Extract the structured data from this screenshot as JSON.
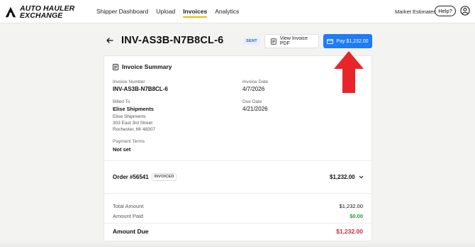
{
  "brand": {
    "line1": "AUTO HAULER",
    "line2": "EXCHANGE"
  },
  "nav": {
    "items": [
      "Shipper Dashboard",
      "Upload",
      "Invoices",
      "Analytics"
    ],
    "active": "Invoices",
    "market_estimates": "Market Estimates",
    "help": "Help?"
  },
  "header": {
    "invoice_id": "INV-AS3B-N7B8CL-6",
    "status": "SENT",
    "view_pdf_label": "View Invoice PDF",
    "pay_label": "Pay $1,232.00"
  },
  "summary": {
    "title": "Invoice Summary",
    "invoice_number_label": "Invoice Number",
    "invoice_number": "INV-AS3B-N7B8CL-6",
    "invoice_date_label": "Invoice Date",
    "invoice_date": "4/7/2026",
    "billed_to_label": "Billed To",
    "billed_to_name": "Elise Shipments",
    "address": [
      "Elise Shipments",
      "303 East 3rd Street",
      "Rochester, MI 48307"
    ],
    "due_date_label": "Due Date",
    "due_date": "4/21/2026",
    "payment_terms_label": "Payment Terms",
    "payment_terms": "Not set"
  },
  "order": {
    "title": "Order #56541",
    "badge": "INVOICED",
    "amount": "$1,232.00"
  },
  "totals": {
    "total_amount_label": "Total Amount",
    "total_amount": "$1,232.00",
    "amount_paid_label": "Amount Paid",
    "amount_paid": "$0.00",
    "amount_due_label": "Amount Due",
    "amount_due": "$1,232.00"
  },
  "colors": {
    "accent_blue": "#1f7cf2",
    "nav_underline": "#f2b705",
    "paid_green": "#1f9d3a",
    "due_red": "#d7263d",
    "annotation_red": "#e8262a"
  },
  "icons": [
    "logo-mark",
    "user-circle-icon",
    "back-arrow-icon",
    "document-icon",
    "credit-card-icon",
    "invoice-doc-icon",
    "chevron-down-icon"
  ]
}
